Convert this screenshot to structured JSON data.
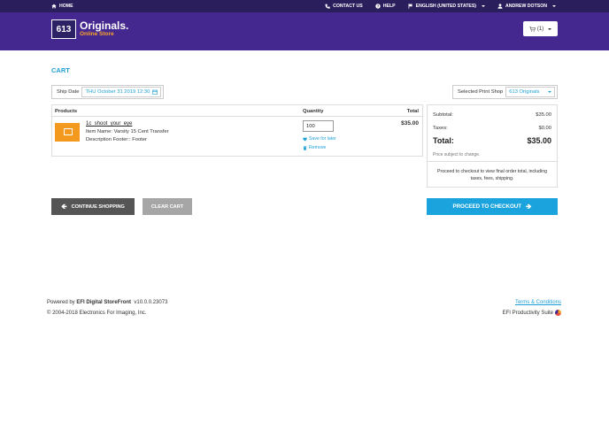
{
  "topbar": {
    "home": "HOME",
    "contact": "CONTACT US",
    "help": "HELP",
    "language": "ENGLISH (UNITED STATES)",
    "user": "ANDREW DOTSON"
  },
  "header": {
    "logo_number": "613",
    "logo_title": "Originals.",
    "logo_subtitle": "Online Store",
    "cart_count": "(1)"
  },
  "page": {
    "title": "CART"
  },
  "ship": {
    "label": "Ship Date",
    "value": "THU October 31 2019 12:30"
  },
  "print_shop": {
    "label": "Selected Print Shop",
    "value": "613 Originals"
  },
  "table": {
    "headers": {
      "products": "Products",
      "quantity": "Quantity",
      "total": "Total"
    },
    "items": [
      {
        "name": "1c_shoot_your_eye",
        "item_name": "Item Name: Varsity 15 Cent Transfer",
        "description": "Description Footer:: Footer",
        "quantity": "100",
        "price": "$35.00",
        "save_label": "Save for later",
        "remove_label": "Remove"
      }
    ]
  },
  "summary": {
    "subtotal_label": "Subtotal:",
    "subtotal": "$35.00",
    "taxes_label": "Taxes:",
    "taxes": "$0.00",
    "total_label": "Total:",
    "total": "$35.00",
    "subject": "Price subject to change.",
    "note": "Proceed to checkout to view final order total, including taxes, fees, shipping."
  },
  "buttons": {
    "continue": "CONTINUE SHOPPING",
    "clear": "CLEAR CART",
    "checkout": "PROCEED TO CHECKOUT"
  },
  "footer": {
    "powered_prefix": "Powered by ",
    "powered_brand": "EFI Digital StoreFront",
    "version": "v10.0.0.23073",
    "copyright": "© 2004-2018 Electronics For Imaging, Inc.",
    "terms": "Terms & Conditions",
    "suite": "EFI Productivity Suite"
  },
  "colors": {
    "topbar": "#2a1e5c",
    "header": "#44288f",
    "accent": "#1ea0d6",
    "orange": "#f39a1e"
  }
}
